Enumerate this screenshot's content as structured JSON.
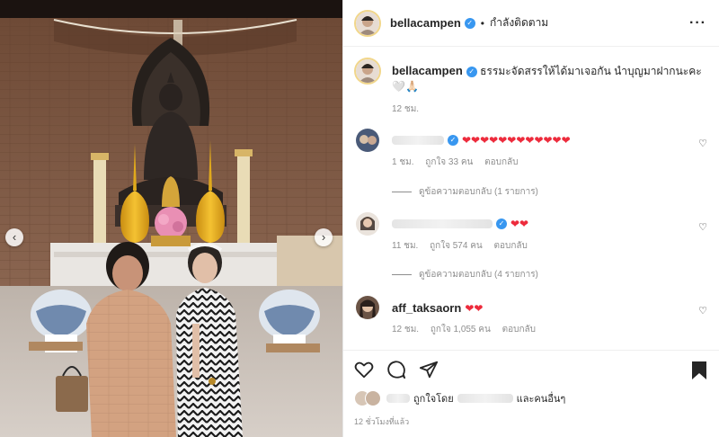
{
  "post": {
    "username": "bellacampen",
    "follow_status": "กำลังติดตาม",
    "dot": "•",
    "more_icon": "more-horizontal-icon",
    "caption": "ธรรมะจัดสรรให้ได้มาเจอกัน นำบุญมาฝากนะคะ🤍🙏🏻",
    "caption_time": "12 ชม.",
    "verified_color": "#3897f0"
  },
  "comments": [
    {
      "hearts": "❤❤❤❤❤❤❤❤❤❤❤❤",
      "time": "1 ชม.",
      "likes": "ถูกใจ 33 คน",
      "reply_label": "ตอบกลับ",
      "view_replies": "ดูข้อความตอบกลับ (1 รายการ)"
    },
    {
      "hearts": "❤❤",
      "time": "11 ชม.",
      "likes": "ถูกใจ 574 คน",
      "reply_label": "ตอบกลับ",
      "view_replies": "ดูข้อความตอบกลับ (4 รายการ)"
    },
    {
      "username": "aff_taksaorn",
      "hearts": "❤❤",
      "time": "12 ชม.",
      "likes": "ถูกใจ 1,055 คน",
      "reply_label": "ตอบกลับ"
    }
  ],
  "footer": {
    "liked_by": "ถูกใจโดย",
    "and_others": "และคนอื่นๆ",
    "post_time": "12 ชั่วโมงที่แล้ว"
  },
  "icons": {
    "prev": "‹",
    "next": "›",
    "heart_outline": "♡"
  },
  "colors": {
    "heart_red": "#ed2b3c",
    "muted": "#8e8e8e",
    "text": "#262626"
  }
}
